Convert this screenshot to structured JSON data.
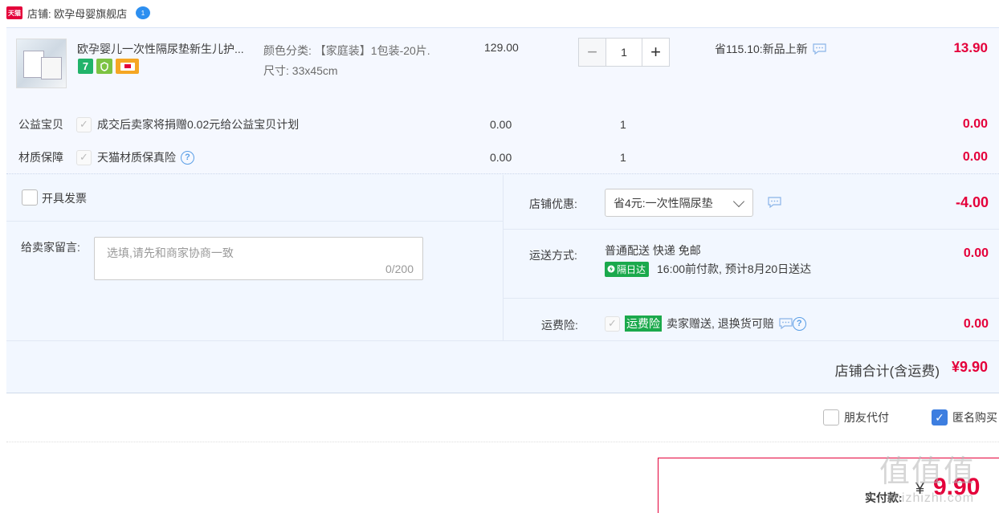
{
  "store": {
    "logo_text": "天猫",
    "label": "店铺: 欧孕母婴旗舰店",
    "ww_badge": "1"
  },
  "item": {
    "title": "欧孕婴儿一次性隔尿垫新生儿护...",
    "sku_color": "颜色分类: 【家庭装】1包装-20片.",
    "sku_size": "尺寸: 33x45cm",
    "unit_price": "129.00",
    "quantity": "1",
    "minus": "−",
    "plus": "+",
    "promo": "省115.10:新品上新",
    "subtotal": "13.90",
    "badge_seven": "7"
  },
  "services": [
    {
      "label": "公益宝贝",
      "desc": "成交后卖家将捐赠0.02元给公益宝贝计划",
      "price": "0.00",
      "qty": "1",
      "total": "0.00"
    },
    {
      "label": "材质保障",
      "desc": "天猫材质保真险",
      "price": "0.00",
      "qty": "1",
      "total": "0.00"
    }
  ],
  "invoice": {
    "label": "开具发票"
  },
  "message": {
    "label": "给卖家留言:",
    "placeholder": "选填,请先和商家协商一致",
    "counter": "0/200"
  },
  "shop_discount": {
    "label": "店铺优惠:",
    "selected": "省4元:一次性隔尿垫",
    "amount": "-4.00"
  },
  "shipping": {
    "label": "运送方式:",
    "method": "普通配送 快递 免邮",
    "tag": "隔日达",
    "eta": "16:00前付款, 预计8月20日送达",
    "amount": "0.00"
  },
  "insurance": {
    "label": "运费险:",
    "tag": "运费险",
    "desc": "卖家赠送, 退换货可赔",
    "amount": "0.00"
  },
  "store_total": {
    "label": "店铺合计(含运费)",
    "amount": "¥9.90"
  },
  "options": {
    "friend_pay": "朋友代付",
    "anonymous": "匿名购买"
  },
  "payment": {
    "label": "实付款:",
    "yen": "¥",
    "amount": "9.90"
  },
  "watermark": {
    "main": "值值值",
    "sub": "zhizhizhi.com"
  },
  "colors": {
    "accent_red": "#e4003a",
    "green": "#1ba94c",
    "blue": "#3d7ee0",
    "panel_bg": "#f2f7ff"
  }
}
